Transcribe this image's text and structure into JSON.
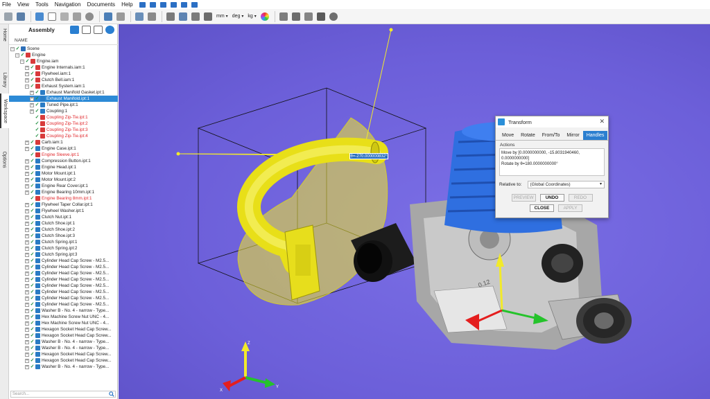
{
  "menu": [
    "File",
    "View",
    "Tools",
    "Navigation",
    "Documents",
    "Help"
  ],
  "toolbar": {
    "unit_length": "mm",
    "unit_angle": "deg",
    "unit_mass": "kg"
  },
  "side_tabs": [
    "Home",
    "Library",
    "Workspace",
    "Options"
  ],
  "panel": {
    "title": "Assembly",
    "column_header": "NAME",
    "search_placeholder": "Search..."
  },
  "tree": [
    {
      "indent": 0,
      "type": "scene",
      "label": "Scene",
      "exp": "-"
    },
    {
      "indent": 1,
      "type": "asm",
      "label": "Engine",
      "exp": "-"
    },
    {
      "indent": 2,
      "type": "asm",
      "label": "Engine.iam",
      "exp": "-"
    },
    {
      "indent": 3,
      "type": "asm",
      "label": "Engine Internals.iam:1",
      "exp": "+"
    },
    {
      "indent": 3,
      "type": "asm",
      "label": "Flywheel.iam:1",
      "exp": "+"
    },
    {
      "indent": 3,
      "type": "asm",
      "label": "Clutch Bell.iam:1",
      "exp": "+"
    },
    {
      "indent": 3,
      "type": "asm",
      "label": "Exhaust System.iam:1",
      "exp": "-"
    },
    {
      "indent": 4,
      "type": "part",
      "label": "Exhaust Manifold Gasket.ipt:1",
      "exp": "+"
    },
    {
      "indent": 4,
      "type": "part",
      "label": "Exhaust Manifold.ipt:1",
      "exp": "+",
      "selected": true
    },
    {
      "indent": 4,
      "type": "part",
      "label": "Tuned Pipe.ipt:1",
      "exp": "+"
    },
    {
      "indent": 4,
      "type": "part",
      "label": "Coupling:1",
      "exp": "+"
    },
    {
      "indent": 4,
      "type": "asm",
      "label": "Coupling Zip-Tie.ipt:1",
      "exp": "",
      "red": true
    },
    {
      "indent": 4,
      "type": "asm",
      "label": "Coupling Zip-Tie.ipt:2",
      "exp": "",
      "red": true
    },
    {
      "indent": 4,
      "type": "asm",
      "label": "Coupling Zip-Tie.ipt:3",
      "exp": "",
      "red": true
    },
    {
      "indent": 4,
      "type": "asm",
      "label": "Coupling Zip-Tie.ipt:4",
      "exp": "",
      "red": true
    },
    {
      "indent": 3,
      "type": "asm",
      "label": "Carb.iam:1",
      "exp": "+"
    },
    {
      "indent": 3,
      "type": "part",
      "label": "Engine Case.ipt:1",
      "exp": "+"
    },
    {
      "indent": 3,
      "type": "asm",
      "label": "Engine Sleeve.ipt:1",
      "exp": "",
      "red": true
    },
    {
      "indent": 3,
      "type": "part",
      "label": "Compression Button.ipt:1",
      "exp": "+"
    },
    {
      "indent": 3,
      "type": "part",
      "label": "Engine Head.ipt:1",
      "exp": "+"
    },
    {
      "indent": 3,
      "type": "part",
      "label": "Motor Mount.ipt:1",
      "exp": "+"
    },
    {
      "indent": 3,
      "type": "part",
      "label": "Motor Mount.ipt:2",
      "exp": "+"
    },
    {
      "indent": 3,
      "type": "part",
      "label": "Engine Rear Cover.ipt:1",
      "exp": "+"
    },
    {
      "indent": 3,
      "type": "part",
      "label": "Engine Bearing 10mm.ipt:1",
      "exp": "+"
    },
    {
      "indent": 3,
      "type": "asm",
      "label": "Engine Bearing 8mm.ipt:1",
      "exp": "",
      "red": true
    },
    {
      "indent": 3,
      "type": "part",
      "label": "Flywheel Taper Collar.ipt:1",
      "exp": "+"
    },
    {
      "indent": 3,
      "type": "part",
      "label": "Flywheel Washer.ipt:1",
      "exp": "+"
    },
    {
      "indent": 3,
      "type": "part",
      "label": "Clutch Nut.ipt:1",
      "exp": "+"
    },
    {
      "indent": 3,
      "type": "part",
      "label": "Clutch Shoe.ipt:1",
      "exp": "+"
    },
    {
      "indent": 3,
      "type": "part",
      "label": "Clutch Shoe.ipt:2",
      "exp": "+"
    },
    {
      "indent": 3,
      "type": "part",
      "label": "Clutch Shoe.ipt:3",
      "exp": "+"
    },
    {
      "indent": 3,
      "type": "part",
      "label": "Clutch Spring.ipt:1",
      "exp": "+"
    },
    {
      "indent": 3,
      "type": "part",
      "label": "Clutch Spring.ipt:2",
      "exp": "+"
    },
    {
      "indent": 3,
      "type": "part",
      "label": "Clutch Spring.ipt:3",
      "exp": "+"
    },
    {
      "indent": 3,
      "type": "part",
      "label": "Cylinder Head Cap Screw - M2.5...",
      "exp": "+"
    },
    {
      "indent": 3,
      "type": "part",
      "label": "Cylinder Head Cap Screw - M2.5...",
      "exp": "+"
    },
    {
      "indent": 3,
      "type": "part",
      "label": "Cylinder Head Cap Screw - M2.5...",
      "exp": "+"
    },
    {
      "indent": 3,
      "type": "part",
      "label": "Cylinder Head Cap Screw - M2.5...",
      "exp": "+"
    },
    {
      "indent": 3,
      "type": "part",
      "label": "Cylinder Head Cap Screw - M2.5...",
      "exp": "+"
    },
    {
      "indent": 3,
      "type": "part",
      "label": "Cylinder Head Cap Screw - M2.5...",
      "exp": "+"
    },
    {
      "indent": 3,
      "type": "part",
      "label": "Cylinder Head Cap Screw - M2.5...",
      "exp": "+"
    },
    {
      "indent": 3,
      "type": "part",
      "label": "Cylinder Head Cap Screw - M2.5...",
      "exp": "+"
    },
    {
      "indent": 3,
      "type": "part",
      "label": "Washer B - No. 4 - narrow - Type...",
      "exp": "+"
    },
    {
      "indent": 3,
      "type": "part",
      "label": "Hex Machine Screw Nut UNC - 4...",
      "exp": "+"
    },
    {
      "indent": 3,
      "type": "part",
      "label": "Hex Machine Screw Nut UNC - 4...",
      "exp": "+"
    },
    {
      "indent": 3,
      "type": "part",
      "label": "Hexagon Socket Head Cap Screw...",
      "exp": "+"
    },
    {
      "indent": 3,
      "type": "part",
      "label": "Hexagon Socket Head Cap Screw...",
      "exp": "+"
    },
    {
      "indent": 3,
      "type": "part",
      "label": "Washer B - No. 4 - narrow - Type...",
      "exp": "+"
    },
    {
      "indent": 3,
      "type": "part",
      "label": "Washer B - No. 4 - narrow - Type...",
      "exp": "+"
    },
    {
      "indent": 3,
      "type": "part",
      "label": "Hexagon Socket Head Cap Screw...",
      "exp": "+"
    },
    {
      "indent": 3,
      "type": "part",
      "label": "Hexagon Socket Head Cap Screw...",
      "exp": "+"
    },
    {
      "indent": 3,
      "type": "part",
      "label": "Washer B - No. 4 - narrow - Type...",
      "exp": "+"
    }
  ],
  "viewport": {
    "angle_readout": "θ=-270.000000832°",
    "engine_marking": "0.12",
    "axis_labels": {
      "x": "X",
      "y": "Y",
      "z": "Z"
    }
  },
  "transform_dialog": {
    "title": "Transform",
    "tabs": [
      "Move",
      "Rotate",
      "From/To",
      "Mirror",
      "Handles"
    ],
    "active_tab": "Handles",
    "actions_label": "Actions",
    "actions": [
      "Move by [0.0000000000, -15.8031940460, 0.0000000000]",
      "Rotate by θ=180.0000000000°"
    ],
    "relative_to_label": "Relative to:",
    "relative_to_value": "(Global Coordinates)",
    "buttons_row1": [
      "PREVIEW",
      "UNDO",
      "REDO"
    ],
    "buttons_row2": [
      "CLOSE",
      "APPLY"
    ]
  },
  "colors": {
    "viewport_bg": "#6c5fd9",
    "selection": "#2c8ad6",
    "highlight_yellow": "#f2ea2a",
    "engine_blue": "#2f6fe0"
  }
}
